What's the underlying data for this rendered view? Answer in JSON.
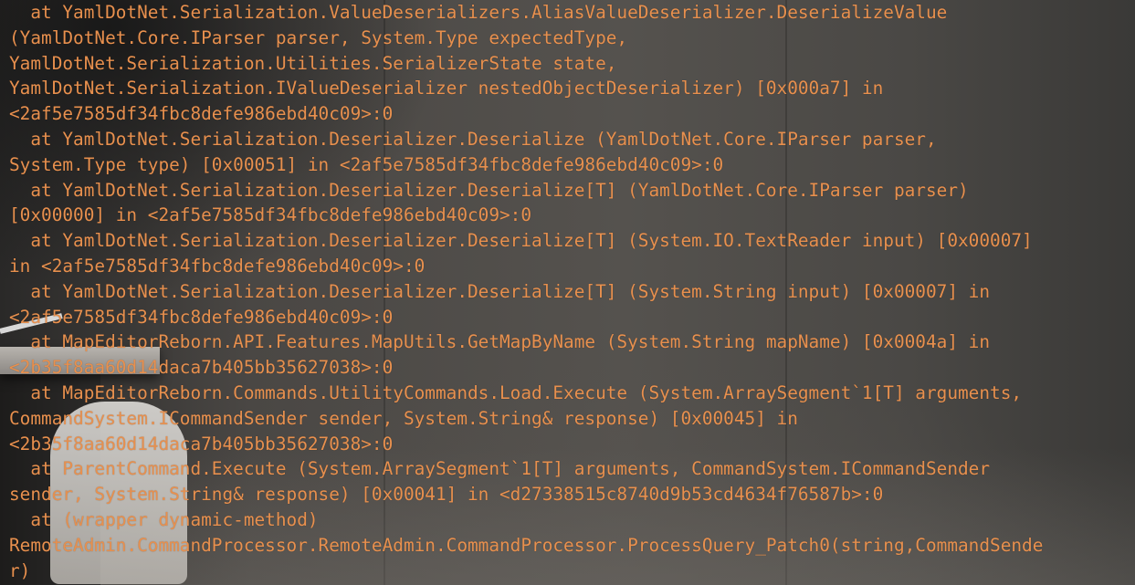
{
  "console": {
    "lines": [
      "  at YamlDotNet.Serialization.ValueDeserializers.AliasValueDeserializer.DeserializeValue",
      "(YamlDotNet.Core.IParser parser, System.Type expectedType,",
      "YamlDotNet.Serialization.Utilities.SerializerState state,",
      "YamlDotNet.Serialization.IValueDeserializer nestedObjectDeserializer) [0x000a7] in",
      "<2af5e7585df34fbc8defe986ebd40c09>:0",
      "  at YamlDotNet.Serialization.Deserializer.Deserialize (YamlDotNet.Core.IParser parser,",
      "System.Type type) [0x00051] in <2af5e7585df34fbc8defe986ebd40c09>:0",
      "  at YamlDotNet.Serialization.Deserializer.Deserialize[T] (YamlDotNet.Core.IParser parser)",
      "[0x00000] in <2af5e7585df34fbc8defe986ebd40c09>:0",
      "  at YamlDotNet.Serialization.Deserializer.Deserialize[T] (System.IO.TextReader input) [0x00007]",
      "in <2af5e7585df34fbc8defe986ebd40c09>:0",
      "  at YamlDotNet.Serialization.Deserializer.Deserialize[T] (System.String input) [0x00007] in",
      "<2af5e7585df34fbc8defe986ebd40c09>:0",
      "  at MapEditorReborn.API.Features.MapUtils.GetMapByName (System.String mapName) [0x0004a] in",
      "<2b35f8aa60d14daca7b405bb35627038>:0",
      "  at MapEditorReborn.Commands.UtilityCommands.Load.Execute (System.ArraySegment`1[T] arguments,",
      "CommandSystem.ICommandSender sender, System.String& response) [0x00045] in",
      "<2b35f8aa60d14daca7b405bb35627038>:0",
      "  at ParentCommand.Execute (System.ArraySegment`1[T] arguments, CommandSystem.ICommandSender",
      "sender, System.String& response) [0x00041] in <d27338515c8740d9b53cd4634f76587b>:0",
      "  at (wrapper dynamic-method)",
      "RemoteAdmin.CommandProcessor.RemoteAdmin.CommandProcessor.ProcessQuery_Patch0(string,CommandSende",
      "r)"
    ]
  },
  "colors": {
    "console_text": "#e8904e"
  }
}
